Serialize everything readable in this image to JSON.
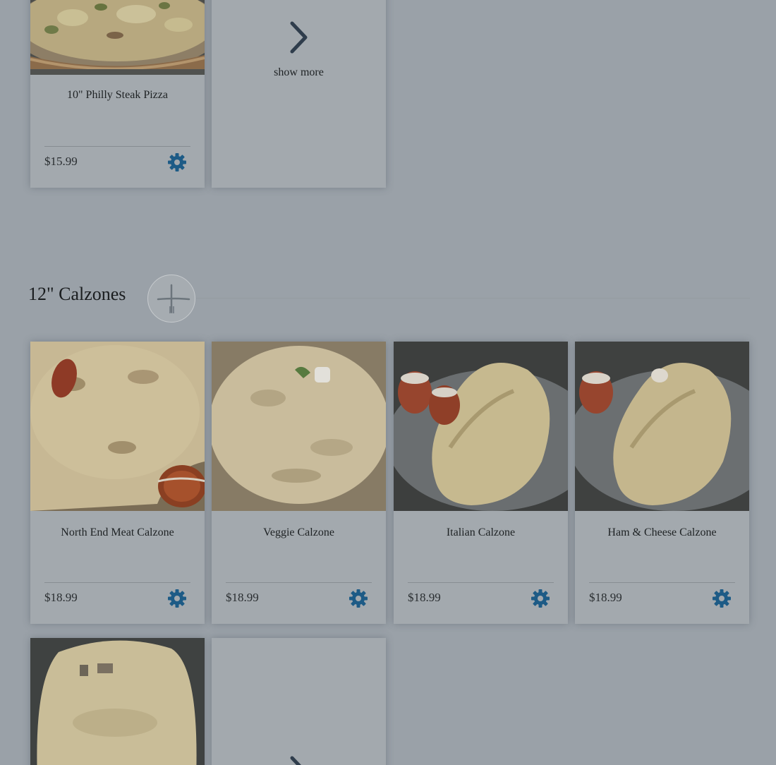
{
  "top_row": {
    "items": [
      {
        "name": "10\" Philly Steak Pizza",
        "price": "$15.99",
        "image": "philly-steak-pizza-photo"
      }
    ],
    "show_more_label": "show more"
  },
  "section": {
    "title": "12\" Calzones",
    "icon": "fork-knife-icon"
  },
  "calzones": {
    "items": [
      {
        "name": "North End Meat Calzone",
        "price": "$18.99",
        "image": "north-end-meat-calzone-photo"
      },
      {
        "name": "Veggie Calzone",
        "price": "$18.99",
        "image": "veggie-calzone-photo"
      },
      {
        "name": "Italian Calzone",
        "price": "$18.99",
        "image": "italian-calzone-photo"
      },
      {
        "name": "Ham & Cheese Calzone",
        "price": "$18.99",
        "image": "ham-cheese-calzone-photo"
      }
    ],
    "partial_item_image": "calzone-photo"
  },
  "colors": {
    "overlay_bg": "#9aa1a8",
    "card_bg": "#a3a9ae",
    "gear_icon": "#1d5b86",
    "text": "#1e2224"
  }
}
